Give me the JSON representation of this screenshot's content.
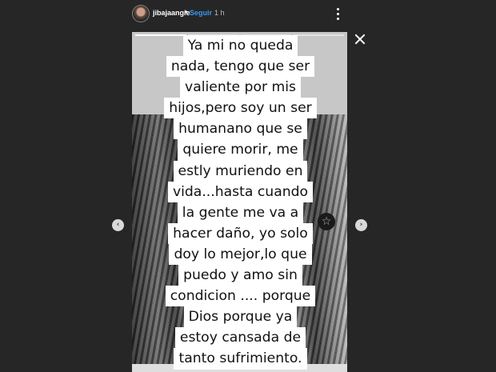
{
  "header": {
    "username": "jibajaangie",
    "separator": "•",
    "follow_label": "Seguir",
    "time": "1 h"
  },
  "story": {
    "progress": {
      "segments": 4,
      "active_index": 0
    },
    "text_lines": [
      "Ya mi no queda",
      "nada, tengo que ser",
      "valiente por mis",
      "hijos,pero soy un ser",
      "humanano que se",
      "quiere morir, me",
      "estly muriendo en",
      "vida...hasta cuando",
      "la gente me va a",
      "hacer daño, yo solo",
      "doy lo mejor,lo que",
      "puedo y amo sin",
      "condicion .... porque",
      "Dios porque ya",
      "estoy cansada de",
      "tanto sufrimiento."
    ]
  },
  "icons": {
    "close": "close-icon",
    "more": "more-options-icon",
    "prev": "chevron-left-icon",
    "next": "chevron-right-icon"
  },
  "nav": {
    "prev_glyph": "‹",
    "next_glyph": "›"
  },
  "colors": {
    "background": "#262626",
    "follow": "#3897f0"
  }
}
